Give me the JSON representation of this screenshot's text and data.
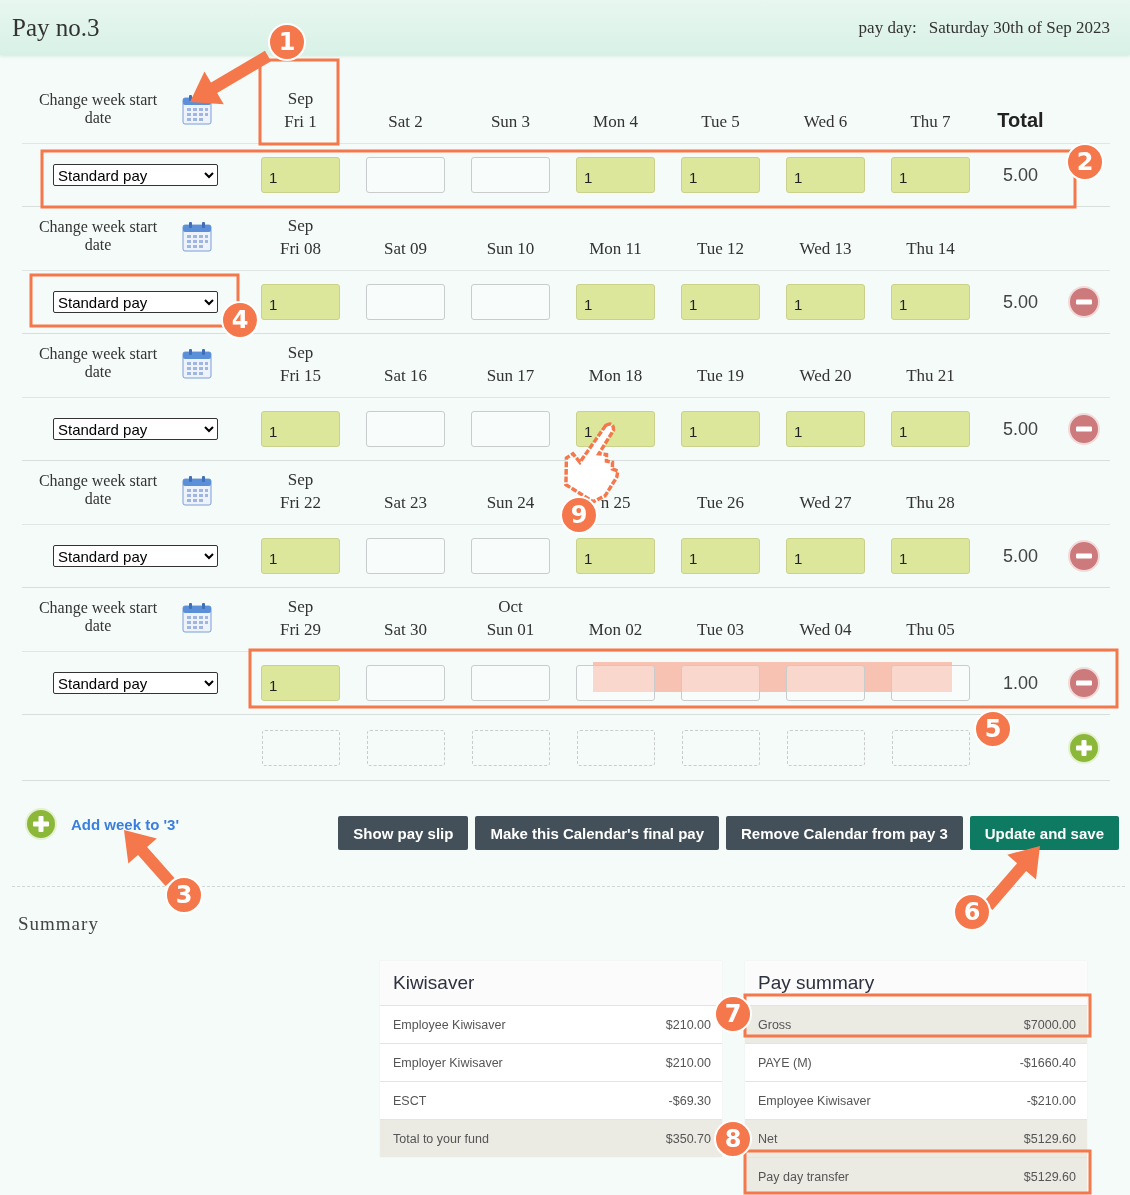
{
  "header": {
    "title": "Pay no.3",
    "pay_day_label": "pay day:",
    "pay_day": "Saturday 30th of Sep 2023"
  },
  "total_heading": "Total",
  "weeks": [
    {
      "change_label": "Change week start date",
      "days": [
        {
          "month": "Sep",
          "label": "Fri 1"
        },
        {
          "label": "Sat 2"
        },
        {
          "label": "Sun 3"
        },
        {
          "label": "Mon 4"
        },
        {
          "label": "Tue 5"
        },
        {
          "label": "Wed 6"
        },
        {
          "label": "Thu 7"
        }
      ],
      "pay_type": "Standard pay",
      "entries": [
        {
          "filled": true,
          "value": "1"
        },
        {
          "filled": false
        },
        {
          "filled": false
        },
        {
          "filled": true,
          "value": "1"
        },
        {
          "filled": true,
          "value": "1"
        },
        {
          "filled": true,
          "value": "1"
        },
        {
          "filled": true,
          "value": "1"
        }
      ],
      "total": "5.00",
      "removable": false
    },
    {
      "change_label": "Change week start date",
      "days": [
        {
          "month": "Sep",
          "label": "Fri 08"
        },
        {
          "label": "Sat 09"
        },
        {
          "label": "Sun 10"
        },
        {
          "label": "Mon 11"
        },
        {
          "label": "Tue 12"
        },
        {
          "label": "Wed 13"
        },
        {
          "label": "Thu 14"
        }
      ],
      "pay_type": "Standard pay",
      "entries": [
        {
          "filled": true,
          "value": "1"
        },
        {
          "filled": false
        },
        {
          "filled": false
        },
        {
          "filled": true,
          "value": "1"
        },
        {
          "filled": true,
          "value": "1"
        },
        {
          "filled": true,
          "value": "1"
        },
        {
          "filled": true,
          "value": "1"
        }
      ],
      "total": "5.00",
      "removable": true
    },
    {
      "change_label": "Change week start date",
      "days": [
        {
          "month": "Sep",
          "label": "Fri 15"
        },
        {
          "label": "Sat 16"
        },
        {
          "label": "Sun 17"
        },
        {
          "label": "Mon 18"
        },
        {
          "label": "Tue 19"
        },
        {
          "label": "Wed 20"
        },
        {
          "label": "Thu 21"
        }
      ],
      "pay_type": "Standard pay",
      "entries": [
        {
          "filled": true,
          "value": "1"
        },
        {
          "filled": false
        },
        {
          "filled": false
        },
        {
          "filled": true,
          "value": "1"
        },
        {
          "filled": true,
          "value": "1"
        },
        {
          "filled": true,
          "value": "1"
        },
        {
          "filled": true,
          "value": "1"
        }
      ],
      "total": "5.00",
      "removable": true
    },
    {
      "change_label": "Change week start date",
      "days": [
        {
          "month": "Sep",
          "label": "Fri 22"
        },
        {
          "label": "Sat 23"
        },
        {
          "label": "Sun 24"
        },
        {
          "label": "n 25"
        },
        {
          "label": "Tue 26"
        },
        {
          "label": "Wed 27"
        },
        {
          "label": "Thu 28"
        }
      ],
      "pay_type": "Standard pay",
      "entries": [
        {
          "filled": true,
          "value": "1"
        },
        {
          "filled": false
        },
        {
          "filled": false
        },
        {
          "filled": true,
          "value": "1"
        },
        {
          "filled": true,
          "value": "1"
        },
        {
          "filled": true,
          "value": "1"
        },
        {
          "filled": true,
          "value": "1"
        }
      ],
      "total": "5.00",
      "removable": true
    },
    {
      "change_label": "Change week start date",
      "days": [
        {
          "month": "Sep",
          "label": "Fri 29"
        },
        {
          "label": "Sat 30"
        },
        {
          "month": "Oct",
          "label": "Sun 01"
        },
        {
          "label": "Mon 02"
        },
        {
          "label": "Tue 03"
        },
        {
          "label": "Wed 04"
        },
        {
          "label": "Thu 05"
        }
      ],
      "pay_type": "Standard pay",
      "entries": [
        {
          "filled": true,
          "value": "1"
        },
        {
          "filled": false
        },
        {
          "filled": false
        },
        {
          "filled": false
        },
        {
          "filled": false
        },
        {
          "filled": false
        },
        {
          "filled": false
        }
      ],
      "total": "1.00",
      "removable": true
    }
  ],
  "add_week_link": "Add week to '3'",
  "buttons": [
    {
      "label": "Show pay slip",
      "kind": "secondary"
    },
    {
      "label": "Make this Calendar's final pay",
      "kind": "secondary"
    },
    {
      "label": "Remove Calendar from pay 3",
      "kind": "secondary"
    },
    {
      "label": "Update and save",
      "kind": "primary"
    }
  ],
  "summary": {
    "heading": "Summary",
    "tables": [
      {
        "title": "Kiwisaver",
        "rows": [
          {
            "label": "Employee Kiwisaver",
            "amount": "$210.00",
            "shaded": false
          },
          {
            "label": "Employer Kiwisaver",
            "amount": "$210.00",
            "shaded": false
          },
          {
            "label": "ESCT",
            "amount": "-$69.30",
            "shaded": false
          },
          {
            "label": "Total to your fund",
            "amount": "$350.70",
            "shaded": true
          }
        ]
      },
      {
        "title": "Pay summary",
        "rows": [
          {
            "label": "Gross",
            "amount": "$7000.00",
            "shaded": true
          },
          {
            "label": "PAYE (M)",
            "amount": "-$1660.40",
            "shaded": false
          },
          {
            "label": "Employee Kiwisaver",
            "amount": "-$210.00",
            "shaded": false
          },
          {
            "label": "Net",
            "amount": "$5129.60",
            "shaded": true
          },
          {
            "label": "Pay day transfer",
            "amount": "$5129.60",
            "shaded": true
          }
        ]
      }
    ]
  },
  "annotations": [
    {
      "number": "1"
    },
    {
      "number": "2"
    },
    {
      "number": "3"
    },
    {
      "number": "4"
    },
    {
      "number": "5"
    },
    {
      "number": "6"
    },
    {
      "number": "7"
    },
    {
      "number": "8"
    },
    {
      "number": "9"
    }
  ]
}
